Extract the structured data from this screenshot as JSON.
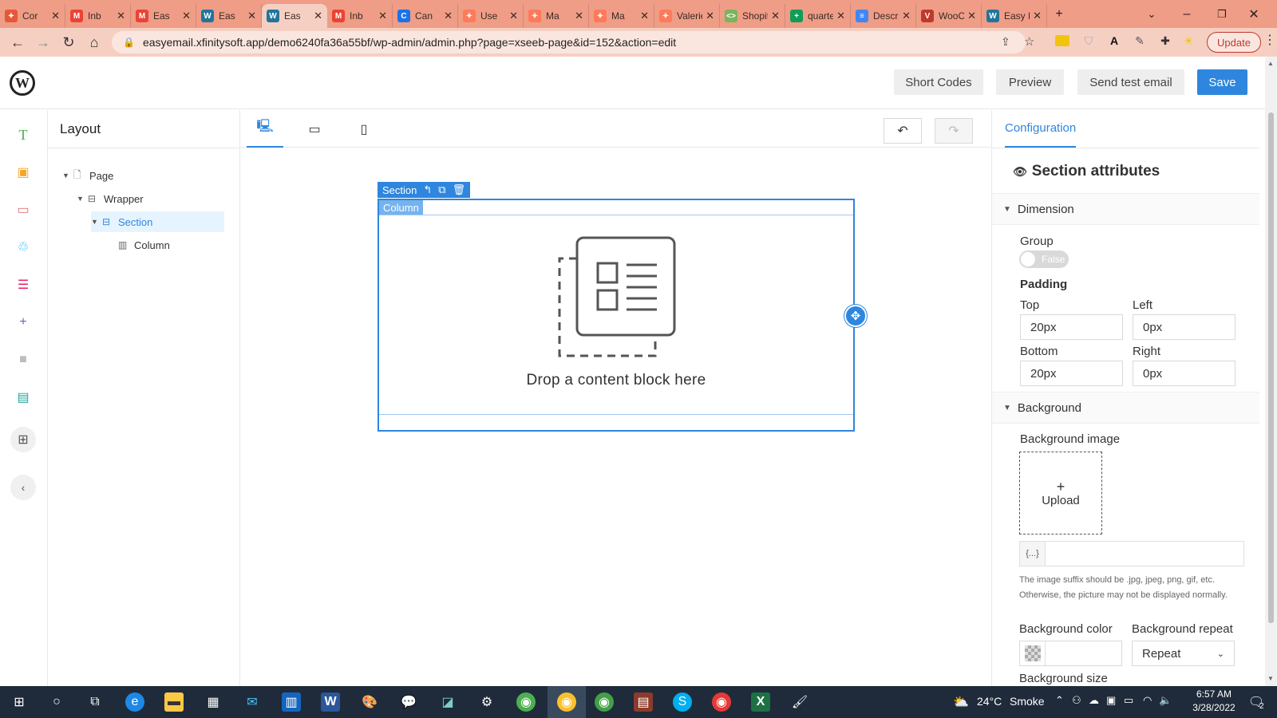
{
  "browser": {
    "tabs": [
      {
        "label": "Cor",
        "fav_color": "#e8563a",
        "fav_glyph": "✦"
      },
      {
        "label": "Inb",
        "fav_color": "#ea4335",
        "fav_glyph": "M"
      },
      {
        "label": "Eas",
        "fav_color": "#ea4335",
        "fav_glyph": "M"
      },
      {
        "label": "Eas",
        "fav_color": "#21759b",
        "fav_glyph": "W"
      },
      {
        "label": "Eas",
        "fav_color": "#21759b",
        "fav_glyph": "W",
        "active": true
      },
      {
        "label": "Inb",
        "fav_color": "#ea4335",
        "fav_glyph": "M"
      },
      {
        "label": "Can",
        "fav_color": "#1a73e8",
        "fav_glyph": "C"
      },
      {
        "label": "Use",
        "fav_color": "#ff7a59",
        "fav_glyph": "✦"
      },
      {
        "label": "Ma",
        "fav_color": "#ff7a59",
        "fav_glyph": "✦"
      },
      {
        "label": "Ma",
        "fav_color": "#ff7a59",
        "fav_glyph": "✦"
      },
      {
        "label": "Valerie",
        "fav_color": "#ff7a59",
        "fav_glyph": "✦"
      },
      {
        "label": "Shopify",
        "fav_color": "#7ab55c",
        "fav_glyph": "<>"
      },
      {
        "label": "quarter",
        "fav_color": "#0f9d58",
        "fav_glyph": "+"
      },
      {
        "label": "Descrip",
        "fav_color": "#4285f4",
        "fav_glyph": "≡"
      },
      {
        "label": "WooCo",
        "fav_color": "#c0392b",
        "fav_glyph": "V"
      },
      {
        "label": "Easy Em",
        "fav_color": "#21759b",
        "fav_glyph": "W"
      }
    ],
    "new_tab": "+",
    "url": "easyemail.xfinitysoft.app/demo6240fa36a55bf/wp-admin/admin.php?page=xseeb-page&id=152&action=edit",
    "update_label": "Update"
  },
  "header": {
    "short_codes": "Short Codes",
    "preview": "Preview",
    "send_test": "Send test email",
    "save": "Save"
  },
  "layout_panel": {
    "title": "Layout",
    "tree": [
      {
        "label": "Page"
      },
      {
        "label": "Wrapper"
      },
      {
        "label": "Section",
        "selected": true
      },
      {
        "label": "Column"
      }
    ]
  },
  "canvas": {
    "section_tag": "Section",
    "column_tag": "Column",
    "drop_text": "Drop a content block here"
  },
  "config": {
    "tab": "Configuration",
    "title": "Section attributes",
    "dimension": {
      "heading": "Dimension",
      "group_label": "Group",
      "group_toggle": "False",
      "padding_label": "Padding",
      "top_label": "Top",
      "top_value": "20px",
      "left_label": "Left",
      "left_value": "0px",
      "bottom_label": "Bottom",
      "bottom_value": "20px",
      "right_label": "Right",
      "right_value": "0px"
    },
    "background": {
      "heading": "Background",
      "image_label": "Background image",
      "upload_label": "Upload",
      "var_addon": "{...}",
      "hint": "The image suffix should be .jpg, jpeg, png, gif, etc. Otherwise, the picture may not be displayed normally.",
      "color_label": "Background color",
      "repeat_label": "Background repeat",
      "repeat_value": "Repeat",
      "size_label": "Background size"
    }
  },
  "taskbar": {
    "weather_temp": "24°C",
    "weather_text": "Smoke",
    "time": "6:57 AM",
    "date": "3/28/2022",
    "notifications": "2"
  },
  "colors": {
    "accent": "#2e86de",
    "tabstrip": "#ef9d86"
  }
}
